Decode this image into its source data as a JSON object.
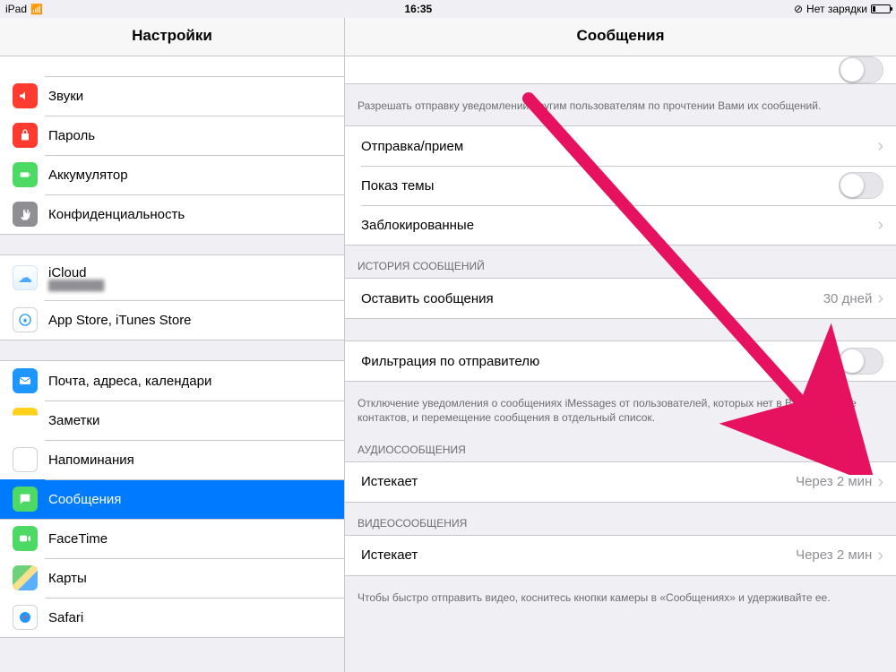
{
  "statusbar": {
    "device": "iPad",
    "time": "16:35",
    "charging_text": "Нет зарядки"
  },
  "sidebar": {
    "title": "Настройки",
    "group1": [
      {
        "label": "Звуки",
        "icon": "sounds-icon",
        "color": "#ff3b30"
      },
      {
        "label": "Пароль",
        "icon": "lock-icon",
        "color": "#ff3b30"
      },
      {
        "label": "Аккумулятор",
        "icon": "battery-icon",
        "color": "#4cd964"
      },
      {
        "label": "Конфиденциальность",
        "icon": "hand-icon",
        "color": "#8e8e93"
      }
    ],
    "group2": [
      {
        "label": "iCloud",
        "sub": "████████",
        "icon": "icloud-icon"
      },
      {
        "label": "App Store, iTunes Store",
        "icon": "appstore-icon",
        "color": "#1e96ff"
      }
    ],
    "group3": [
      {
        "label": "Почта, адреса, календари",
        "icon": "mail-icon",
        "color": "#1e96ff"
      },
      {
        "label": "Заметки",
        "icon": "notes-icon",
        "color": "#ffcc00"
      },
      {
        "label": "Напоминания",
        "icon": "reminders-icon",
        "color": "#ffffff"
      },
      {
        "label": "Сообщения",
        "icon": "messages-icon",
        "color": "#4cd964",
        "selected": true
      },
      {
        "label": "FaceTime",
        "icon": "facetime-icon",
        "color": "#4cd964"
      },
      {
        "label": "Карты",
        "icon": "maps-icon",
        "color": "#ffffff"
      },
      {
        "label": "Safari",
        "icon": "safari-icon",
        "color": "#1e96ff"
      }
    ]
  },
  "detail": {
    "title": "Сообщения",
    "read_receipts_footer": "Разрешать отправку уведомлений другим пользователям по прочтении Вами их сообщений.",
    "rows": {
      "send_receive": "Отправка/прием",
      "show_subject": "Показ темы",
      "blocked": "Заблокированные"
    },
    "history_header": "ИСТОРИЯ СООБЩЕНИЙ",
    "keep_messages": {
      "label": "Оставить сообщения",
      "value": "30 дней"
    },
    "filter": {
      "label": "Фильтрация по отправителю"
    },
    "filter_footer": "Отключение уведомления о сообщениях iMessages от пользователей, которых нет в Вашем списке контактов, и перемещение сообщения  в отдельный список.",
    "audio_header": "АУДИОСООБЩЕНИЯ",
    "audio_expire": {
      "label": "Истекает",
      "value": "Через 2 мин"
    },
    "video_header": "ВИДЕОСООБЩЕНИЯ",
    "video_expire": {
      "label": "Истекает",
      "value": "Через 2 мин"
    },
    "video_footer": "Чтобы быстро отправить видео, коснитесь кнопки камеры в «Сообщениях» и удерживайте ее."
  }
}
